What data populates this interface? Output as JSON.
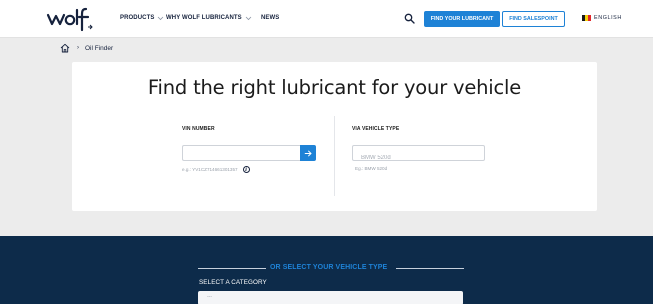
{
  "header": {
    "logo_text": "wolf",
    "nav": [
      {
        "label": "PRODUCTS"
      },
      {
        "label": "WHY WOLF LUBRICANTS"
      },
      {
        "label": "NEWS"
      }
    ],
    "find_lubricant_label": "FIND YOUR LUBRICANT",
    "find_salespoint_label": "FIND SALESPOINT",
    "language_label": "ENGLISH"
  },
  "breadcrumb": {
    "current": "Oil Finder"
  },
  "finder": {
    "title": "Find the right lubricant for your vehicle",
    "vin": {
      "label": "VIN NUMBER",
      "value": "",
      "hint": "e.g.: YV1CZ714661301357"
    },
    "vehicle_type": {
      "label": "VIA VEHICLE TYPE",
      "placeholder": "BMW 520d",
      "hint": "Eg.: BMW 520d"
    }
  },
  "category_section": {
    "title": "OR SELECT YOUR VEHICLE TYPE",
    "category_label": "SELECT A CATEGORY",
    "category_value": "---"
  },
  "colors": {
    "accent": "#1e82d6",
    "navy": "#0d2b4a",
    "text_dark": "#16223d"
  }
}
